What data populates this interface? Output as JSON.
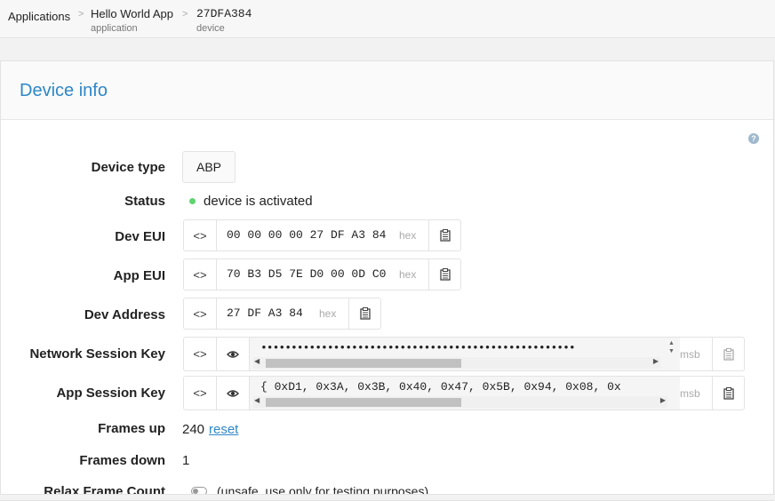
{
  "breadcrumb": [
    {
      "title": "Applications",
      "subtitle": ""
    },
    {
      "title": "Hello World App",
      "subtitle": "application"
    },
    {
      "title": "27DFA384",
      "subtitle": "device"
    }
  ],
  "breadcrumb_separator": ">",
  "card": {
    "title": "Device info",
    "help_icon": "?"
  },
  "device_type": {
    "label": "Device type",
    "value": "ABP"
  },
  "status": {
    "label": "Status",
    "text": "device is activated",
    "dot_color": "#5fd36f"
  },
  "dev_eui": {
    "label": "Dev EUI",
    "value": "00 00 00 00 27 DF A3 84",
    "format": "hex"
  },
  "app_eui": {
    "label": "App EUI",
    "value": "70 B3 D5 7E D0 00 0D C0",
    "format": "hex"
  },
  "dev_address": {
    "label": "Dev Address",
    "value": "27 DF A3 84",
    "format": "hex"
  },
  "nwk_session_key": {
    "label": "Network Session Key",
    "value": "••••••••••••••••••••••••••••••••••••••••••••••••••••",
    "format": "msb"
  },
  "app_session_key": {
    "label": "App Session Key",
    "value": "{ 0xD1, 0x3A, 0x3B, 0x40, 0x47, 0x5B, 0x94, 0x08, 0x",
    "format": "msb"
  },
  "frames_up": {
    "label": "Frames up",
    "value": "240",
    "reset_label": "reset"
  },
  "frames_down": {
    "label": "Frames down",
    "value": "1"
  },
  "relax_frame_count": {
    "label": "Relax Frame Count",
    "note": "(unsafe, use only for testing purposes)",
    "enabled": false
  },
  "icons": {
    "toggle_format": "<>",
    "show": "eye-icon",
    "copy": "clipboard-icon"
  },
  "colors": {
    "accent": "#2e87c7",
    "active": "#5fd36f"
  }
}
